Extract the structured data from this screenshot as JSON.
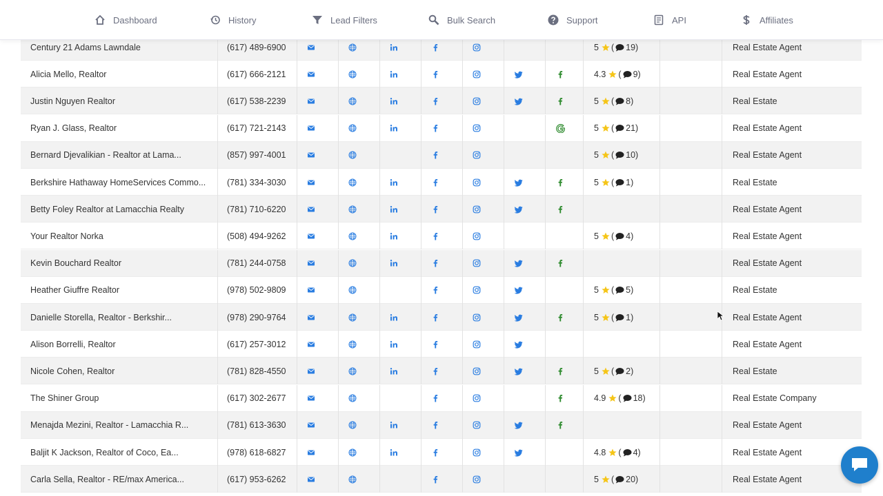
{
  "nav": [
    {
      "label": "Dashboard",
      "icon": "home-icon"
    },
    {
      "label": "History",
      "icon": "history-icon"
    },
    {
      "label": "Lead Filters",
      "icon": "filter-icon"
    },
    {
      "label": "Bulk Search",
      "icon": "search-icon"
    },
    {
      "label": "Support",
      "icon": "help-icon"
    },
    {
      "label": "API",
      "icon": "document-icon"
    },
    {
      "label": "Affiliates",
      "icon": "dollar-icon"
    }
  ],
  "colors": {
    "blue": "#2a7de1",
    "green": "#2e8b2e",
    "star": "#f5c518",
    "chat": "#1f7fcc"
  },
  "rows": [
    {
      "name": "Century 21 Adams Lawndale",
      "phone": "(617) 489-6900",
      "linkedin": true,
      "twitter": false,
      "extra": "",
      "rating": "5",
      "reviews": "19",
      "category": "Real Estate Agent"
    },
    {
      "name": "Alicia Mello, Realtor",
      "phone": "(617) 666-2121",
      "linkedin": true,
      "twitter": true,
      "extra": "facebook",
      "rating": "4.3",
      "reviews": "9",
      "category": "Real Estate Agent"
    },
    {
      "name": "Justin Nguyen Realtor",
      "phone": "(617) 538-2239",
      "linkedin": true,
      "twitter": true,
      "extra": "facebook",
      "rating": "5",
      "reviews": "8",
      "category": "Real Estate"
    },
    {
      "name": "Ryan J. Glass, Realtor",
      "phone": "(617) 721-2143",
      "linkedin": true,
      "twitter": false,
      "extra": "google",
      "rating": "5",
      "reviews": "21",
      "category": "Real Estate Agent"
    },
    {
      "name": "Bernard Djevalikian - Realtor at Lama...",
      "phone": "(857) 997-4001",
      "linkedin": false,
      "twitter": false,
      "extra": "",
      "rating": "5",
      "reviews": "10",
      "category": "Real Estate Agent"
    },
    {
      "name": "Berkshire Hathaway HomeServices Commo...",
      "phone": "(781) 334-3030",
      "linkedin": true,
      "twitter": true,
      "extra": "facebook",
      "rating": "5",
      "reviews": "1",
      "category": "Real Estate"
    },
    {
      "name": "Betty Foley Realtor at Lamacchia Realty",
      "phone": "(781) 710-6220",
      "linkedin": true,
      "twitter": true,
      "extra": "facebook",
      "rating": "",
      "reviews": "",
      "category": "Real Estate Agent"
    },
    {
      "name": "Your Realtor Norka",
      "phone": "(508) 494-9262",
      "linkedin": true,
      "twitter": false,
      "extra": "",
      "rating": "5",
      "reviews": "4",
      "category": "Real Estate Agent"
    },
    {
      "name": "Kevin Bouchard Realtor",
      "phone": "(781) 244-0758",
      "linkedin": true,
      "twitter": true,
      "extra": "facebook",
      "rating": "",
      "reviews": "",
      "category": "Real Estate Agent"
    },
    {
      "name": "Heather Giuffre Realtor",
      "phone": "(978) 502-9809",
      "linkedin": false,
      "twitter": true,
      "extra": "",
      "rating": "5",
      "reviews": "5",
      "category": "Real Estate"
    },
    {
      "name": "Danielle Storella, Realtor - Berkshir...",
      "phone": "(978) 290-9764",
      "linkedin": true,
      "twitter": true,
      "extra": "facebook",
      "rating": "5",
      "reviews": "1",
      "category": "Real Estate Agent"
    },
    {
      "name": "Alison Borrelli, Realtor",
      "phone": "(617) 257-3012",
      "linkedin": true,
      "twitter": true,
      "extra": "",
      "rating": "",
      "reviews": "",
      "category": "Real Estate Agent"
    },
    {
      "name": "Nicole Cohen, Realtor",
      "phone": "(781) 828-4550",
      "linkedin": true,
      "twitter": true,
      "extra": "facebook",
      "rating": "5",
      "reviews": "2",
      "category": "Real Estate"
    },
    {
      "name": "The Shiner Group",
      "phone": "(617) 302-2677",
      "linkedin": false,
      "twitter": false,
      "extra": "facebook",
      "rating": "4.9",
      "reviews": "18",
      "category": "Real Estate Company"
    },
    {
      "name": "Menajda Mezini, Realtor - Lamacchia R...",
      "phone": "(781) 613-3630",
      "linkedin": true,
      "twitter": true,
      "extra": "facebook",
      "rating": "",
      "reviews": "",
      "category": "Real Estate Agent"
    },
    {
      "name": "Baljit K Jackson, Realtor of Coco, Ea...",
      "phone": "(978) 618-6827",
      "linkedin": true,
      "twitter": true,
      "extra": "",
      "rating": "4.8",
      "reviews": "4",
      "category": "Real Estate Agent"
    },
    {
      "name": "Carla Sella, Realtor - RE/max America...",
      "phone": "(617) 953-6262",
      "linkedin": false,
      "twitter": false,
      "extra": "",
      "rating": "5",
      "reviews": "20",
      "category": "Real Estate Agent"
    }
  ]
}
